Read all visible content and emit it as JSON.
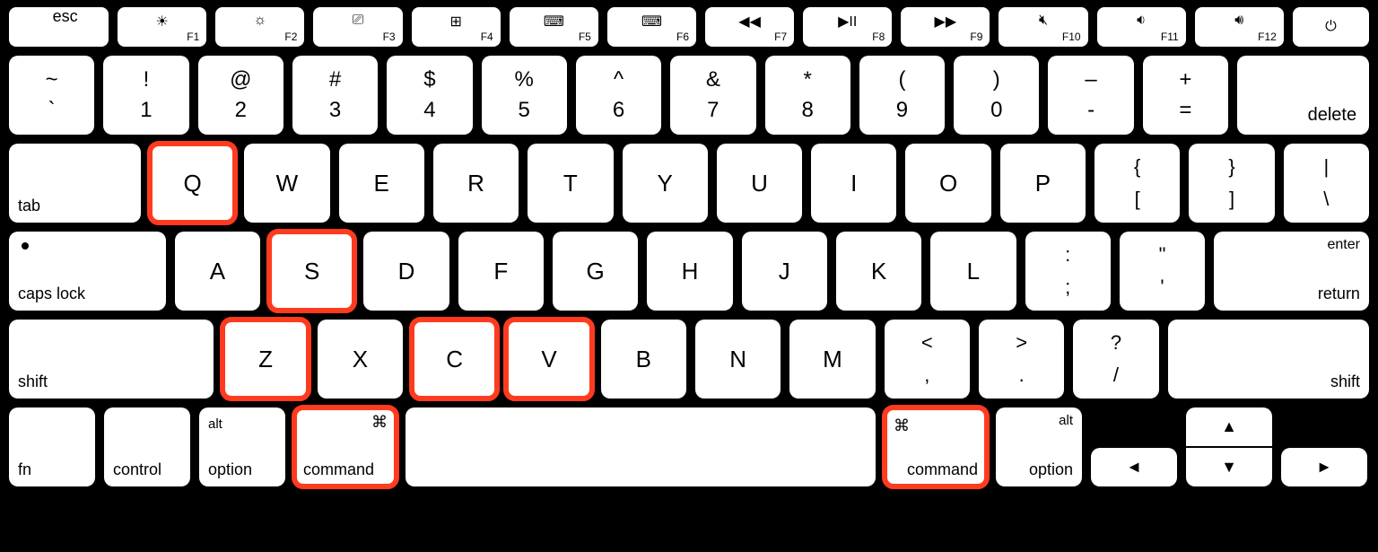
{
  "highlighted_keys": [
    "Q",
    "S",
    "Z",
    "C",
    "V",
    "command-left",
    "command-right"
  ],
  "fn_row": {
    "esc": "esc",
    "keys": [
      {
        "id": "F1",
        "label": "F1",
        "icon": "brightness-down"
      },
      {
        "id": "F2",
        "label": "F2",
        "icon": "brightness-up"
      },
      {
        "id": "F3",
        "label": "F3",
        "icon": "mission-control"
      },
      {
        "id": "F4",
        "label": "F4",
        "icon": "launchpad"
      },
      {
        "id": "F5",
        "label": "F5",
        "icon": "keyboard-light-down"
      },
      {
        "id": "F6",
        "label": "F6",
        "icon": "keyboard-light-up"
      },
      {
        "id": "F7",
        "label": "F7",
        "icon": "rewind"
      },
      {
        "id": "F8",
        "label": "F8",
        "icon": "play-pause"
      },
      {
        "id": "F9",
        "label": "F9",
        "icon": "fast-forward"
      },
      {
        "id": "F10",
        "label": "F10",
        "icon": "mute"
      },
      {
        "id": "F11",
        "label": "F11",
        "icon": "volume-down"
      },
      {
        "id": "F12",
        "label": "F12",
        "icon": "volume-up"
      }
    ],
    "power": "⏻"
  },
  "number_row": {
    "tilde": {
      "top": "~",
      "bottom": "`"
    },
    "keys": [
      {
        "top": "!",
        "bottom": "1"
      },
      {
        "top": "@",
        "bottom": "2"
      },
      {
        "top": "#",
        "bottom": "3"
      },
      {
        "top": "$",
        "bottom": "4"
      },
      {
        "top": "%",
        "bottom": "5"
      },
      {
        "top": "^",
        "bottom": "6"
      },
      {
        "top": "&",
        "bottom": "7"
      },
      {
        "top": "*",
        "bottom": "8"
      },
      {
        "top": "(",
        "bottom": "9"
      },
      {
        "top": ")",
        "bottom": "0"
      },
      {
        "top": "–",
        "bottom": "-"
      },
      {
        "top": "+",
        "bottom": "="
      }
    ],
    "delete": "delete"
  },
  "qwerty_row": {
    "tab": "tab",
    "letters": [
      "Q",
      "W",
      "E",
      "R",
      "T",
      "Y",
      "U",
      "I",
      "O",
      "P"
    ],
    "punct": [
      {
        "top": "{",
        "bottom": "["
      },
      {
        "top": "}",
        "bottom": "]"
      },
      {
        "top": "|",
        "bottom": "\\"
      }
    ]
  },
  "home_row": {
    "caps": "caps lock",
    "letters": [
      "A",
      "S",
      "D",
      "F",
      "G",
      "H",
      "J",
      "K",
      "L"
    ],
    "punct": [
      {
        "top": ":",
        "bottom": ";"
      },
      {
        "top": "\"",
        "bottom": "'"
      }
    ],
    "enter_top": "enter",
    "enter_bottom": "return"
  },
  "shift_row": {
    "shift_left": "shift",
    "letters": [
      "Z",
      "X",
      "C",
      "V",
      "B",
      "N",
      "M"
    ],
    "punct": [
      {
        "top": "<",
        "bottom": ","
      },
      {
        "top": ">",
        "bottom": "."
      },
      {
        "top": "?",
        "bottom": "/"
      }
    ],
    "shift_right": "shift"
  },
  "bottom_row": {
    "fn": "fn",
    "control": "control",
    "option_left_top": "alt",
    "option_left": "option",
    "command_left_icon": "⌘",
    "command_left": "command",
    "command_right_icon": "⌘",
    "command_right": "command",
    "option_right_top": "alt",
    "option_right": "option",
    "arrows": {
      "left": "◄",
      "up": "▲",
      "down": "▼",
      "right": "►"
    }
  },
  "icons": {
    "brightness-down": "☀︎",
    "brightness-up": "☼",
    "mission-control": "⎚",
    "launchpad": "⊞",
    "keyboard-light-down": "⌨︎",
    "keyboard-light-up": "⌨︎",
    "rewind": "◀◀",
    "play-pause": "▶II",
    "fast-forward": "▶▶",
    "mute": "🔇︎",
    "volume-down": "🔉︎",
    "volume-up": "🔊︎"
  }
}
